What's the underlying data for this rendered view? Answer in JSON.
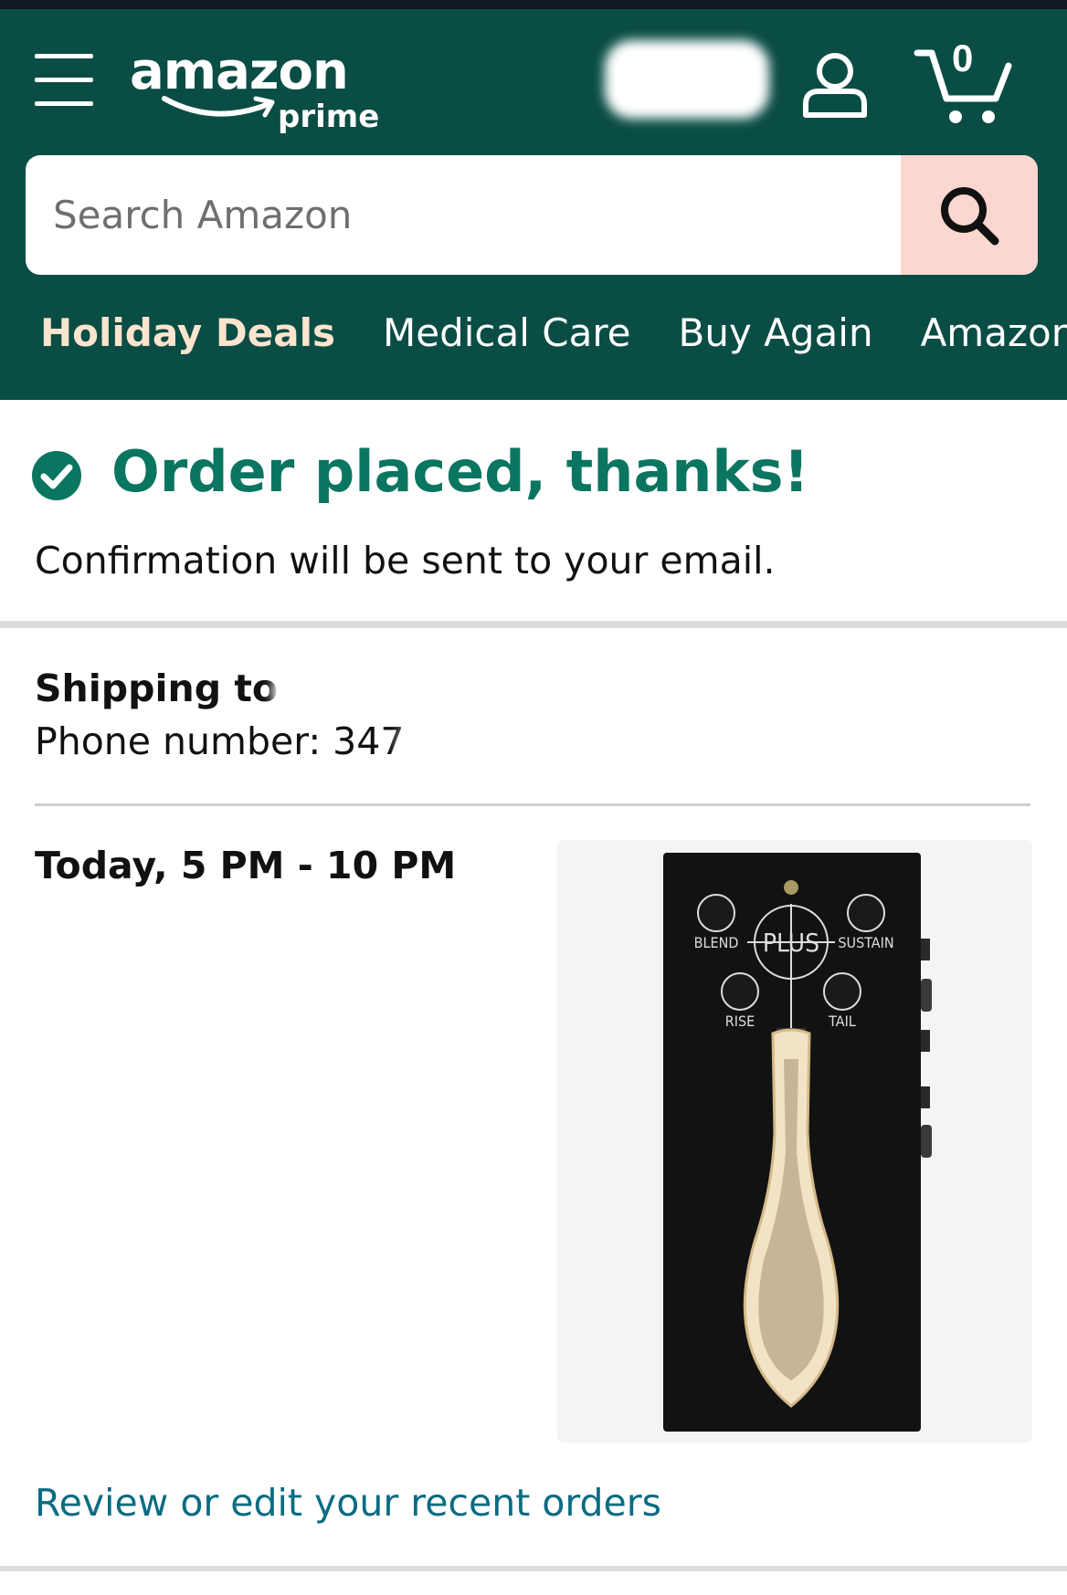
{
  "header": {
    "logo_text": "amazon",
    "logo_sub": "prime",
    "cart_count": "0",
    "search_placeholder": "Search Amazon"
  },
  "nav": [
    "Holiday Deals",
    "Medical Care",
    "Buy Again",
    "Amazon Ba"
  ],
  "confirmation": {
    "title": "Order placed, thanks!",
    "subtitle": "Confirmation will be sent to your email."
  },
  "shipping": {
    "label": "Shipping to",
    "phone_label": "Phone number: 347"
  },
  "delivery": {
    "window": "Today, 5 PM - 10 PM"
  },
  "product_labels": {
    "blend": "BLEND",
    "plus": "PLUS",
    "sustain": "SUSTAIN",
    "rise": "RISE",
    "tail": "TAIL"
  },
  "links": {
    "review": "Review or edit your recent orders"
  },
  "colors": {
    "header_bg": "#0a4d44",
    "accent_green": "#0a7560",
    "link": "#0a6c82",
    "search_button": "#fcd6d0"
  }
}
